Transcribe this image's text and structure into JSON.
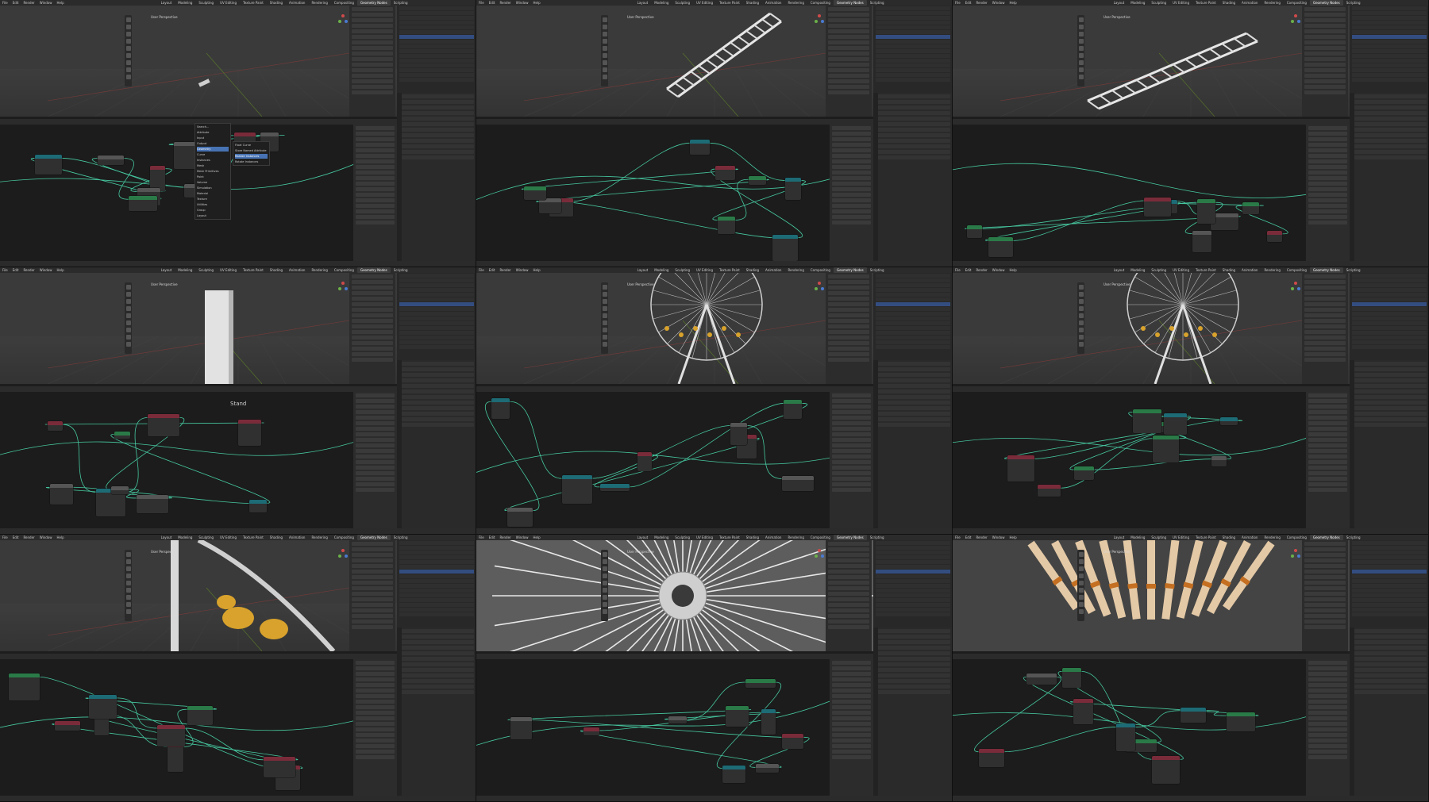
{
  "app": {
    "menus": [
      "File",
      "Edit",
      "Render",
      "Window",
      "Help"
    ],
    "workspaces": [
      "Layout",
      "Modeling",
      "Sculpting",
      "UV Editing",
      "Texture Paint",
      "Shading",
      "Animation",
      "Rendering",
      "Compositing",
      "Geometry Nodes",
      "Scripting"
    ],
    "active_workspace": "Geometry Nodes"
  },
  "tiles": [
    {
      "id": "t1",
      "viewport_label": "User Perspective",
      "node_labels": [],
      "has_menu": true,
      "menu_items": [
        "Search...",
        "Attribute",
        "Input",
        "Output",
        "Geometry",
        "Curve",
        "Instances",
        "Mesh",
        "Mesh Primitives",
        "Point",
        "Volume",
        "Simulation",
        "Material",
        "Texture",
        "Utilities",
        "Group",
        "Layout"
      ],
      "submenu_items": [
        "Float Curve",
        "Store Named Attribute",
        "Realize Instances",
        "Rotate Instances"
      ],
      "object": "small"
    },
    {
      "id": "t2",
      "viewport_label": "User Perspective",
      "node_labels": [],
      "object": "ladder"
    },
    {
      "id": "t3",
      "viewport_label": "User Perspective",
      "node_labels": [],
      "object": "ladder2"
    },
    {
      "id": "t4",
      "viewport_label": "User Perspective",
      "node_labels": [
        "Stand"
      ],
      "object": "stand"
    },
    {
      "id": "t5",
      "viewport_label": "User Perspective",
      "node_labels": [],
      "object": "wheel"
    },
    {
      "id": "t6",
      "viewport_label": "User Perspective",
      "node_labels": [],
      "object": "wheel"
    },
    {
      "id": "t7",
      "viewport_label": "User Perspective",
      "node_labels": [],
      "object": "cabins"
    },
    {
      "id": "t8",
      "viewport_label": "User Perspective",
      "node_labels": [],
      "object": "hub"
    },
    {
      "id": "t9",
      "viewport_label": "User Perspective",
      "node_labels": [],
      "object": "spokes"
    }
  ],
  "colors": {
    "wire": "#46c8a0",
    "accent": "#4772b3",
    "node_teal": "#1d6b75",
    "node_green": "#2a7a48",
    "node_red": "#7a2b3a",
    "cabin_yellow": "#d8a22c"
  }
}
